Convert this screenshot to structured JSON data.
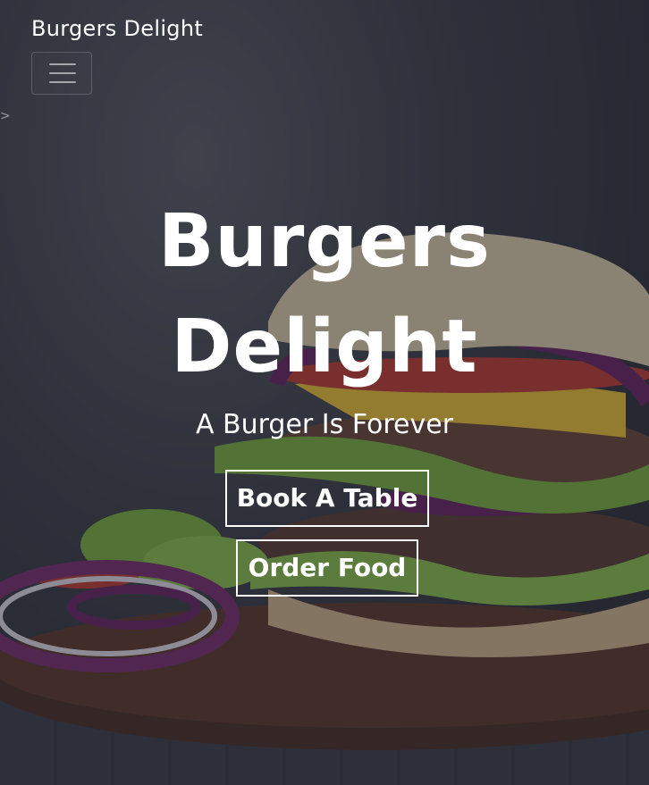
{
  "navbar": {
    "brand": "Burgers Delight",
    "toggler_icon": "hamburger-menu-icon"
  },
  "hero": {
    "title_line1": "Burgers",
    "title_line2": "Delight",
    "tagline": "A Burger Is Forever",
    "buttons": [
      {
        "label": "Book A Table"
      },
      {
        "label": "Order Food"
      }
    ],
    "background_image": "burger-photo",
    "overlay_color": "#1e2432"
  }
}
